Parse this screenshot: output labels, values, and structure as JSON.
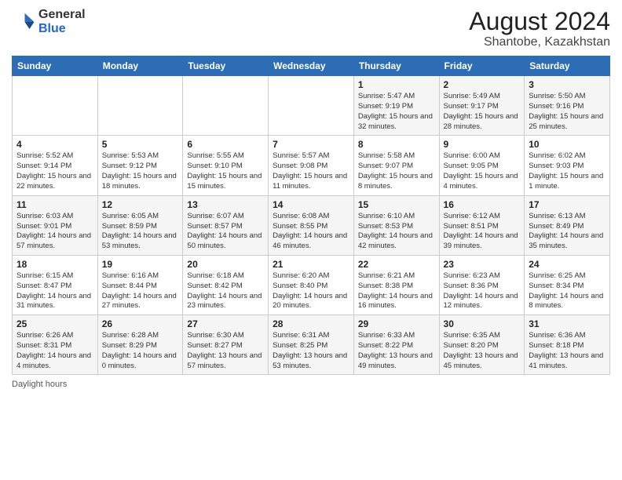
{
  "logo": {
    "general": "General",
    "blue": "Blue"
  },
  "title": "August 2024",
  "subtitle": "Shantobe, Kazakhstan",
  "footer": "Daylight hours",
  "weekdays": [
    "Sunday",
    "Monday",
    "Tuesday",
    "Wednesday",
    "Thursday",
    "Friday",
    "Saturday"
  ],
  "weeks": [
    [
      {
        "day": "",
        "sunrise": "",
        "sunset": "",
        "daylight": ""
      },
      {
        "day": "",
        "sunrise": "",
        "sunset": "",
        "daylight": ""
      },
      {
        "day": "",
        "sunrise": "",
        "sunset": "",
        "daylight": ""
      },
      {
        "day": "",
        "sunrise": "",
        "sunset": "",
        "daylight": ""
      },
      {
        "day": "1",
        "sunrise": "Sunrise: 5:47 AM",
        "sunset": "Sunset: 9:19 PM",
        "daylight": "Daylight: 15 hours and 32 minutes."
      },
      {
        "day": "2",
        "sunrise": "Sunrise: 5:49 AM",
        "sunset": "Sunset: 9:17 PM",
        "daylight": "Daylight: 15 hours and 28 minutes."
      },
      {
        "day": "3",
        "sunrise": "Sunrise: 5:50 AM",
        "sunset": "Sunset: 9:16 PM",
        "daylight": "Daylight: 15 hours and 25 minutes."
      }
    ],
    [
      {
        "day": "4",
        "sunrise": "Sunrise: 5:52 AM",
        "sunset": "Sunset: 9:14 PM",
        "daylight": "Daylight: 15 hours and 22 minutes."
      },
      {
        "day": "5",
        "sunrise": "Sunrise: 5:53 AM",
        "sunset": "Sunset: 9:12 PM",
        "daylight": "Daylight: 15 hours and 18 minutes."
      },
      {
        "day": "6",
        "sunrise": "Sunrise: 5:55 AM",
        "sunset": "Sunset: 9:10 PM",
        "daylight": "Daylight: 15 hours and 15 minutes."
      },
      {
        "day": "7",
        "sunrise": "Sunrise: 5:57 AM",
        "sunset": "Sunset: 9:08 PM",
        "daylight": "Daylight: 15 hours and 11 minutes."
      },
      {
        "day": "8",
        "sunrise": "Sunrise: 5:58 AM",
        "sunset": "Sunset: 9:07 PM",
        "daylight": "Daylight: 15 hours and 8 minutes."
      },
      {
        "day": "9",
        "sunrise": "Sunrise: 6:00 AM",
        "sunset": "Sunset: 9:05 PM",
        "daylight": "Daylight: 15 hours and 4 minutes."
      },
      {
        "day": "10",
        "sunrise": "Sunrise: 6:02 AM",
        "sunset": "Sunset: 9:03 PM",
        "daylight": "Daylight: 15 hours and 1 minute."
      }
    ],
    [
      {
        "day": "11",
        "sunrise": "Sunrise: 6:03 AM",
        "sunset": "Sunset: 9:01 PM",
        "daylight": "Daylight: 14 hours and 57 minutes."
      },
      {
        "day": "12",
        "sunrise": "Sunrise: 6:05 AM",
        "sunset": "Sunset: 8:59 PM",
        "daylight": "Daylight: 14 hours and 53 minutes."
      },
      {
        "day": "13",
        "sunrise": "Sunrise: 6:07 AM",
        "sunset": "Sunset: 8:57 PM",
        "daylight": "Daylight: 14 hours and 50 minutes."
      },
      {
        "day": "14",
        "sunrise": "Sunrise: 6:08 AM",
        "sunset": "Sunset: 8:55 PM",
        "daylight": "Daylight: 14 hours and 46 minutes."
      },
      {
        "day": "15",
        "sunrise": "Sunrise: 6:10 AM",
        "sunset": "Sunset: 8:53 PM",
        "daylight": "Daylight: 14 hours and 42 minutes."
      },
      {
        "day": "16",
        "sunrise": "Sunrise: 6:12 AM",
        "sunset": "Sunset: 8:51 PM",
        "daylight": "Daylight: 14 hours and 39 minutes."
      },
      {
        "day": "17",
        "sunrise": "Sunrise: 6:13 AM",
        "sunset": "Sunset: 8:49 PM",
        "daylight": "Daylight: 14 hours and 35 minutes."
      }
    ],
    [
      {
        "day": "18",
        "sunrise": "Sunrise: 6:15 AM",
        "sunset": "Sunset: 8:47 PM",
        "daylight": "Daylight: 14 hours and 31 minutes."
      },
      {
        "day": "19",
        "sunrise": "Sunrise: 6:16 AM",
        "sunset": "Sunset: 8:44 PM",
        "daylight": "Daylight: 14 hours and 27 minutes."
      },
      {
        "day": "20",
        "sunrise": "Sunrise: 6:18 AM",
        "sunset": "Sunset: 8:42 PM",
        "daylight": "Daylight: 14 hours and 23 minutes."
      },
      {
        "day": "21",
        "sunrise": "Sunrise: 6:20 AM",
        "sunset": "Sunset: 8:40 PM",
        "daylight": "Daylight: 14 hours and 20 minutes."
      },
      {
        "day": "22",
        "sunrise": "Sunrise: 6:21 AM",
        "sunset": "Sunset: 8:38 PM",
        "daylight": "Daylight: 14 hours and 16 minutes."
      },
      {
        "day": "23",
        "sunrise": "Sunrise: 6:23 AM",
        "sunset": "Sunset: 8:36 PM",
        "daylight": "Daylight: 14 hours and 12 minutes."
      },
      {
        "day": "24",
        "sunrise": "Sunrise: 6:25 AM",
        "sunset": "Sunset: 8:34 PM",
        "daylight": "Daylight: 14 hours and 8 minutes."
      }
    ],
    [
      {
        "day": "25",
        "sunrise": "Sunrise: 6:26 AM",
        "sunset": "Sunset: 8:31 PM",
        "daylight": "Daylight: 14 hours and 4 minutes."
      },
      {
        "day": "26",
        "sunrise": "Sunrise: 6:28 AM",
        "sunset": "Sunset: 8:29 PM",
        "daylight": "Daylight: 14 hours and 0 minutes."
      },
      {
        "day": "27",
        "sunrise": "Sunrise: 6:30 AM",
        "sunset": "Sunset: 8:27 PM",
        "daylight": "Daylight: 13 hours and 57 minutes."
      },
      {
        "day": "28",
        "sunrise": "Sunrise: 6:31 AM",
        "sunset": "Sunset: 8:25 PM",
        "daylight": "Daylight: 13 hours and 53 minutes."
      },
      {
        "day": "29",
        "sunrise": "Sunrise: 6:33 AM",
        "sunset": "Sunset: 8:22 PM",
        "daylight": "Daylight: 13 hours and 49 minutes."
      },
      {
        "day": "30",
        "sunrise": "Sunrise: 6:35 AM",
        "sunset": "Sunset: 8:20 PM",
        "daylight": "Daylight: 13 hours and 45 minutes."
      },
      {
        "day": "31",
        "sunrise": "Sunrise: 6:36 AM",
        "sunset": "Sunset: 8:18 PM",
        "daylight": "Daylight: 13 hours and 41 minutes."
      }
    ]
  ]
}
